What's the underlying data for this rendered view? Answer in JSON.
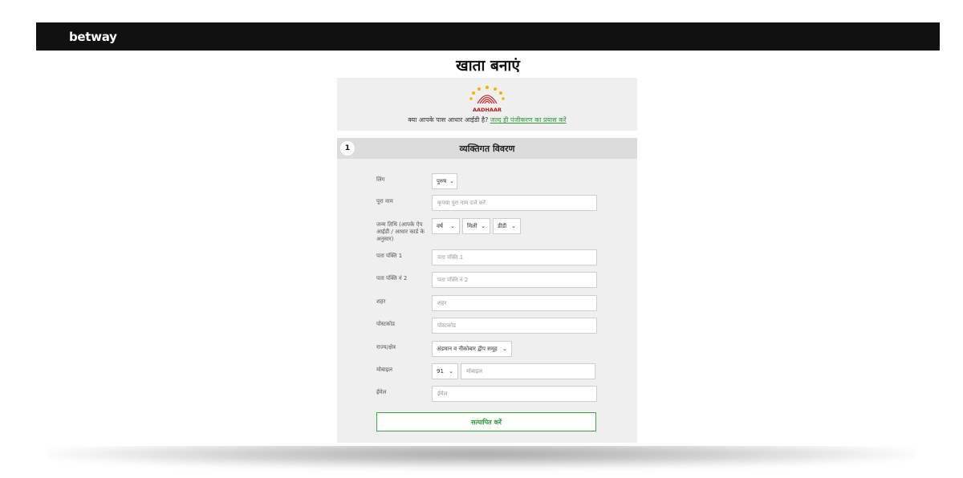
{
  "header": {
    "logo": "betway",
    "colors": {
      "bar": "#111111",
      "accent": "#2e9b3a"
    }
  },
  "page_title": "खाता बनाएं",
  "aadhaar": {
    "logo_text": "AADHAAR",
    "prompt": "क्या आपके पास आधार आईडी है?",
    "link": "जल्द ही पंजीकरण का प्रयास करें"
  },
  "section": {
    "step": "1",
    "title": "व्यक्तिगत विवरण",
    "fields": {
      "gender": {
        "label": "लिंग",
        "value": "पुरुष"
      },
      "full_name": {
        "label": "पूरा नाम",
        "placeholder": "कृपया पूरा नाम दर्ज करें"
      },
      "dob": {
        "label": "जन्म तिथि (आपके ऐप आईडी / आधार कार्ड के अनुसार)",
        "year": "वर्ष",
        "month": "मिली",
        "day": "डीडी"
      },
      "address1": {
        "label": "पता पंक्ति 1",
        "placeholder": "पता पंक्ति 1"
      },
      "address2": {
        "label": "पता पंक्ति नं 2",
        "placeholder": "पता पंक्ति नं 2"
      },
      "city": {
        "label": "शहर",
        "placeholder": "शहर"
      },
      "postcode": {
        "label": "पोस्टकोड",
        "placeholder": "पोस्टकोड"
      },
      "state": {
        "label": "राज्य/क्षेत्र",
        "value": "अंडमान व नीकोबार द्वीप समूह"
      },
      "mobile": {
        "label": "मोबाइल",
        "code": "91",
        "placeholder": "मोबाइल"
      },
      "email": {
        "label": "ईमेल",
        "placeholder": "ईमेल"
      }
    },
    "submit": "सत्यापित करें"
  }
}
